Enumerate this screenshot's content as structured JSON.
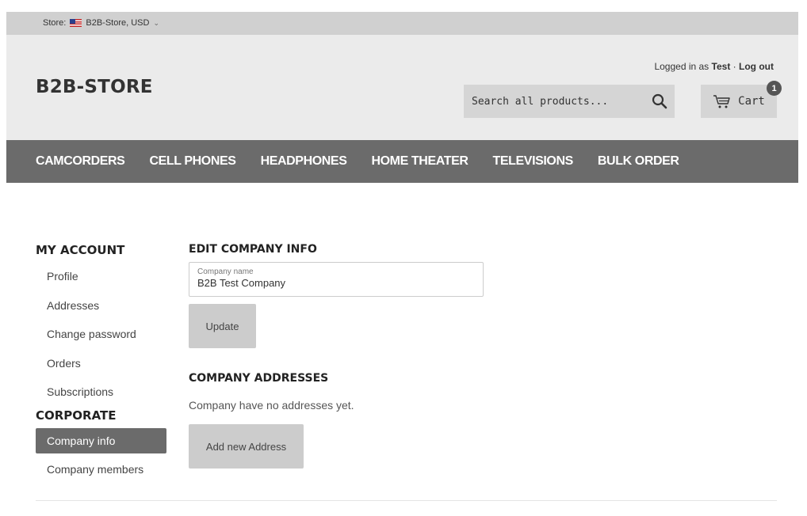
{
  "topbar": {
    "store_label": "Store:",
    "store_value": "B2B-Store, USD"
  },
  "header": {
    "logo": "B2B-STORE",
    "logged_in_prefix": "Logged in as",
    "user_name": "Test",
    "separator": "·",
    "logout_label": "Log out",
    "search_placeholder": "Search all products...",
    "cart_label": "Cart",
    "cart_count": "1"
  },
  "nav": {
    "items": [
      "CAMCORDERS",
      "CELL PHONES",
      "HEADPHONES",
      "HOME THEATER",
      "TELEVISIONS",
      "BULK ORDER"
    ]
  },
  "sidebar": {
    "my_account_title": "MY ACCOUNT",
    "my_account_items": [
      "Profile",
      "Addresses",
      "Change password",
      "Orders",
      "Subscriptions"
    ],
    "corporate_title": "CORPORATE",
    "corporate_items": [
      "Company info",
      "Company members"
    ],
    "active_item": "Company info"
  },
  "main": {
    "edit_title": "EDIT COMPANY INFO",
    "company_name_label": "Company name",
    "company_name_value": "B2B Test Company",
    "update_label": "Update",
    "addresses_title": "COMPANY ADDRESSES",
    "no_addresses_text": "Company have no addresses yet.",
    "add_address_label": "Add new Address"
  },
  "colors": {
    "nav_bg": "#6b6b6b",
    "header_bg": "#ebebeb",
    "topbar_bg": "#d0d0d0",
    "button_bg": "#cccccc"
  }
}
